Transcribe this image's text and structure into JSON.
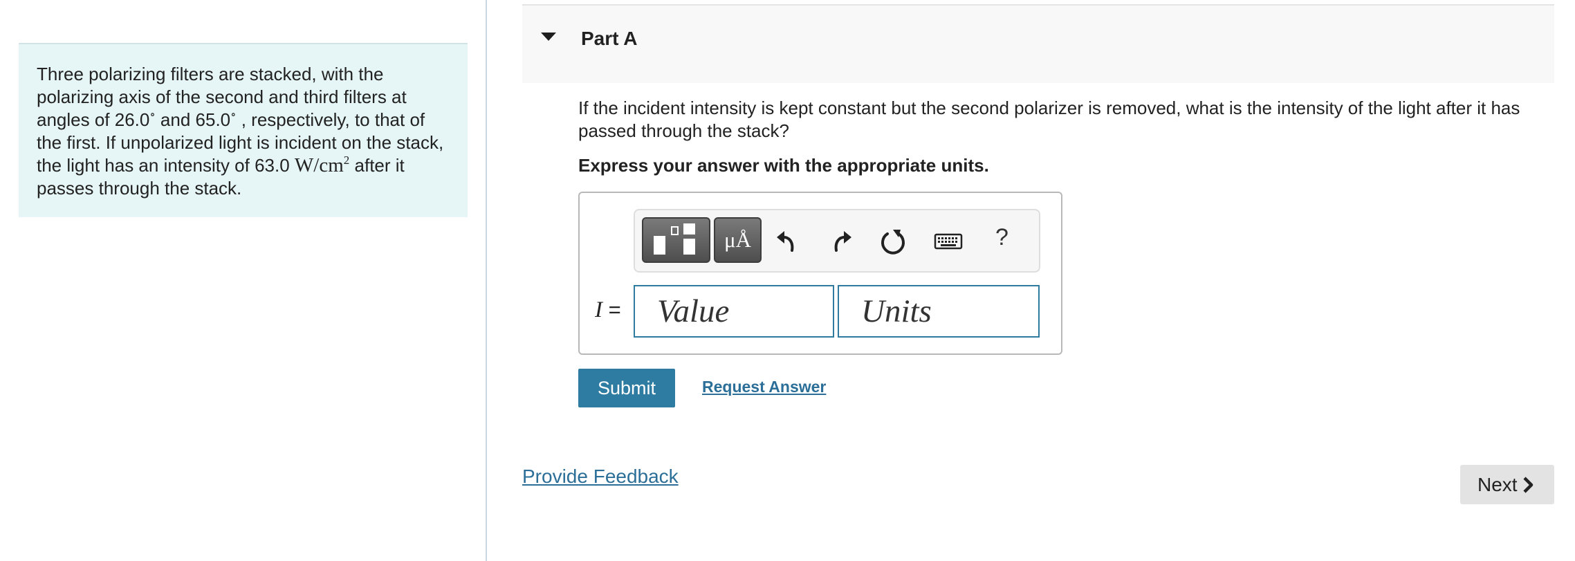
{
  "problem": {
    "text_1": "Three polarizing filters are stacked, with the polarizing axis of the second and third filters at angles of 26.0",
    "degree_1": "∘",
    "text_2": " and 65.0",
    "degree_2": "∘",
    "text_3": " , respectively, to that of the first. If unpolarized light is incident on the stack, the light has an intensity of 63.0 ",
    "intensity_unit": "W/cm",
    "intensity_unit_exp": "2",
    "text_4": " after it passes through the stack."
  },
  "part": {
    "title": "Part A",
    "question": "If the incident intensity is kept constant but the second polarizer is removed, what is the intensity of the light after it has passed through the stack?",
    "instruction": "Express your answer with the appropriate units."
  },
  "toolbar": {
    "units_label": "μÅ",
    "help_label": "?",
    "icons": [
      "templates-icon",
      "units-icon",
      "undo-icon",
      "redo-icon",
      "reset-icon",
      "keyboard-icon",
      "help-icon"
    ]
  },
  "answer": {
    "variable": "I",
    "equals": " =",
    "value_placeholder": "Value",
    "units_placeholder": "Units"
  },
  "actions": {
    "submit_label": "Submit",
    "request_answer_label": "Request Answer",
    "provide_feedback_label": "Provide Feedback",
    "next_label": "Next"
  },
  "colors": {
    "problem_bg": "#e6f5f5",
    "submit_bg": "#2f7ca3",
    "link": "#2b6f99",
    "field_border": "#2f7ba0"
  }
}
